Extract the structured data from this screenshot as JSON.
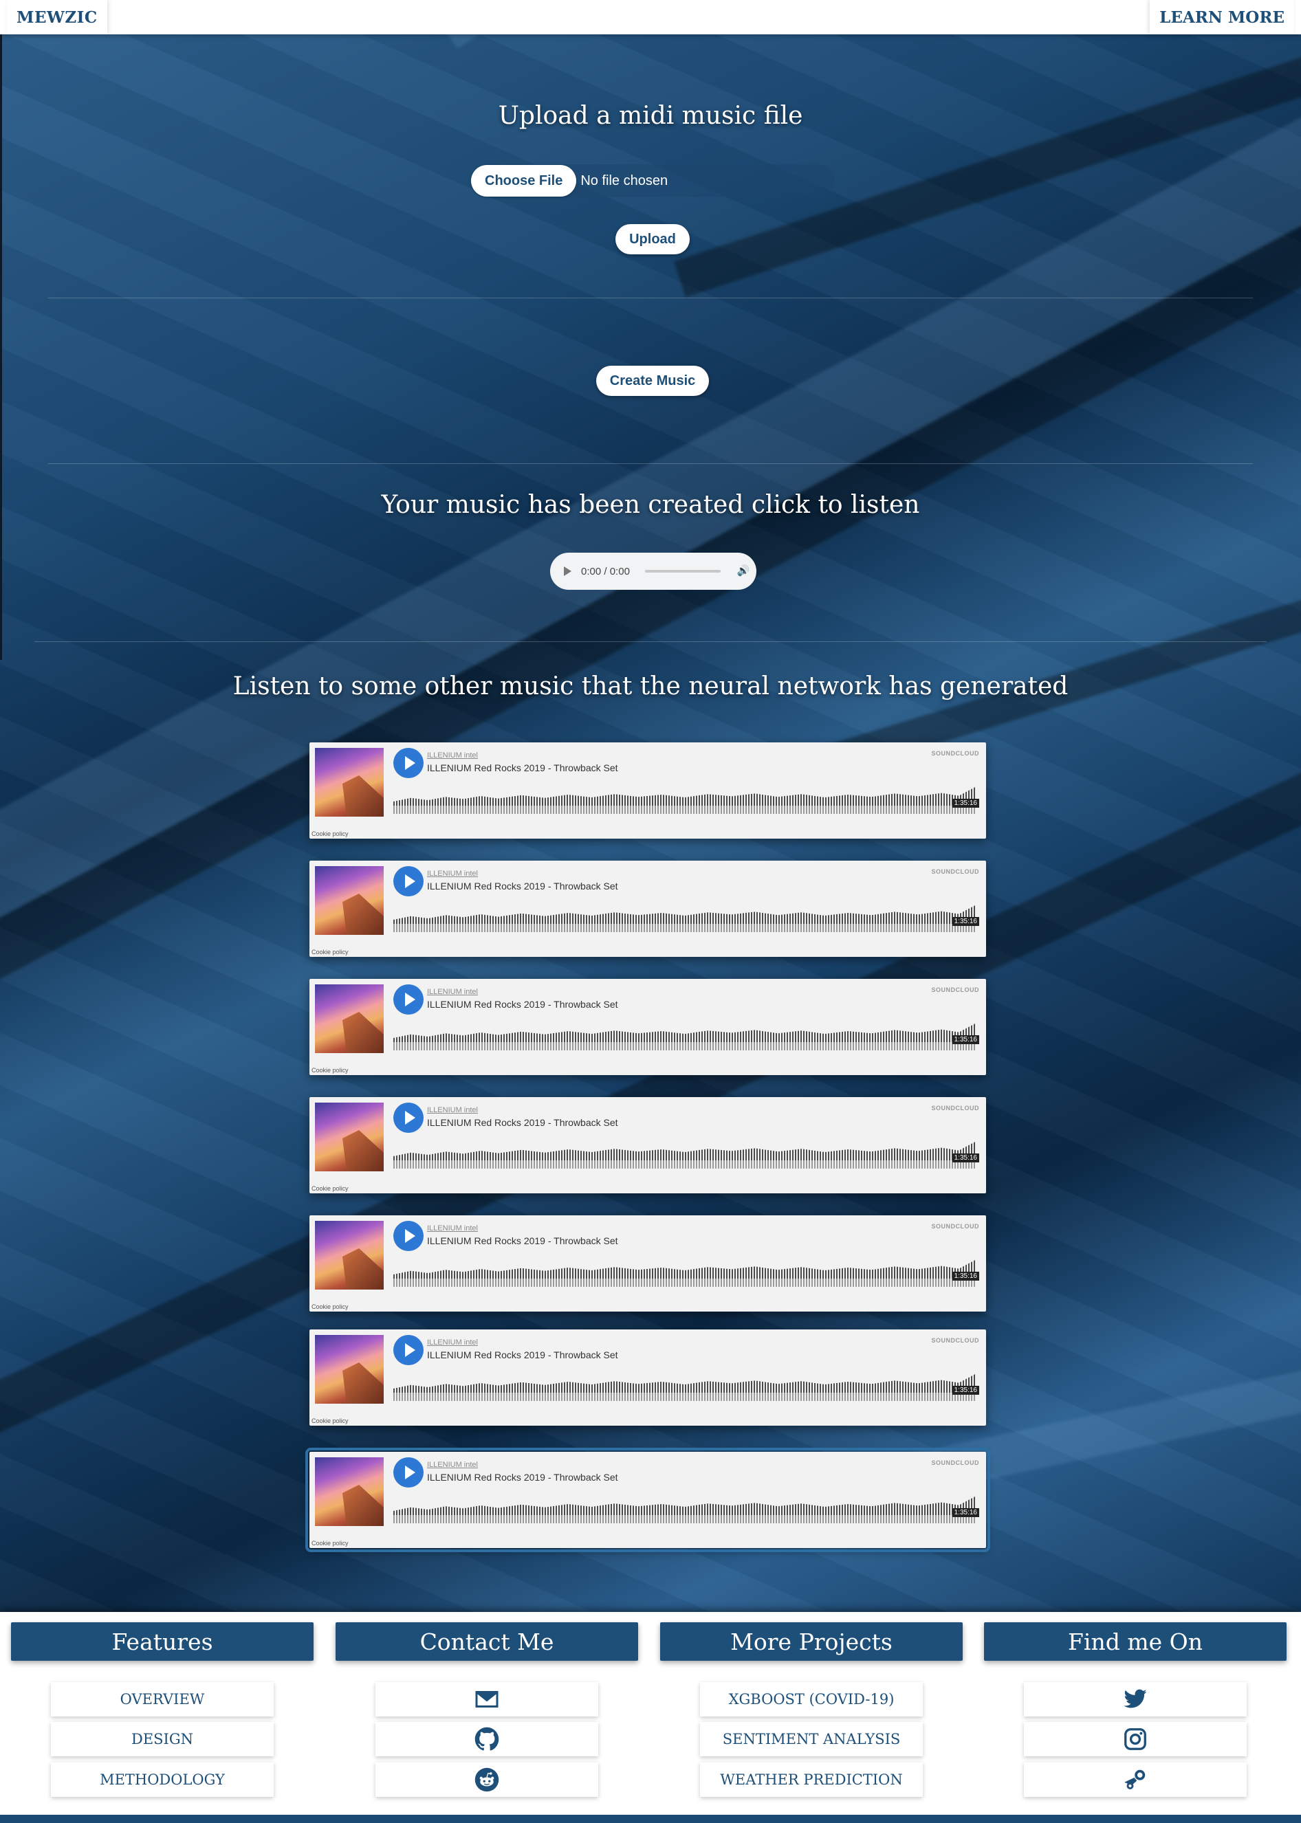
{
  "nav": {
    "brand": "MEWZIC",
    "learn_more": "LEARN MORE"
  },
  "upload": {
    "heading": "Upload a midi music file",
    "choose_file_label": "Choose File",
    "file_status": "No file chosen",
    "upload_button": "Upload"
  },
  "create": {
    "button": "Create Music"
  },
  "result": {
    "heading": "Your music has been created click to listen",
    "player": {
      "current_time": "0:00",
      "duration": "0:00"
    }
  },
  "gallery": {
    "heading": "Listen to some other music that the neural network has generated",
    "tracks": [
      {
        "artist": "ILLENIUM intel",
        "title": "ILLENIUM Red Rocks 2019 - Throwback Set",
        "duration": "1:35:16",
        "brand": "SOUNDCLOUD",
        "cookie": "Cookie policy"
      },
      {
        "artist": "ILLENIUM intel",
        "title": "ILLENIUM Red Rocks 2019 - Throwback Set",
        "duration": "1:35:16",
        "brand": "SOUNDCLOUD",
        "cookie": "Cookie policy"
      },
      {
        "artist": "ILLENIUM intel",
        "title": "ILLENIUM Red Rocks 2019 - Throwback Set",
        "duration": "1:35:16",
        "brand": "SOUNDCLOUD",
        "cookie": "Cookie policy"
      },
      {
        "artist": "ILLENIUM intel",
        "title": "ILLENIUM Red Rocks 2019 - Throwback Set",
        "duration": "1:35:16",
        "brand": "SOUNDCLOUD",
        "cookie": "Cookie policy"
      },
      {
        "artist": "ILLENIUM intel",
        "title": "ILLENIUM Red Rocks 2019 - Throwback Set",
        "duration": "1:35:16",
        "brand": "SOUNDCLOUD",
        "cookie": "Cookie policy"
      },
      {
        "artist": "ILLENIUM intel",
        "title": "ILLENIUM Red Rocks 2019 - Throwback Set",
        "duration": "1:35:16",
        "brand": "SOUNDCLOUD",
        "cookie": "Cookie policy"
      },
      {
        "artist": "ILLENIUM intel",
        "title": "ILLENIUM Red Rocks 2019 - Throwback Set",
        "duration": "1:35:16",
        "brand": "SOUNDCLOUD",
        "cookie": "Cookie policy"
      }
    ]
  },
  "footer": {
    "features": {
      "heading": "Features",
      "items": [
        "OVERVIEW",
        "DESIGN",
        "METHODOLOGY"
      ]
    },
    "contact": {
      "heading": "Contact Me",
      "icons": [
        "envelope-icon",
        "github-icon",
        "reddit-icon"
      ]
    },
    "projects": {
      "heading": "More Projects",
      "items": [
        "XGBOOST (COVID-19)",
        "SENTIMENT ANALYSIS",
        "WEATHER PREDICTION"
      ]
    },
    "social": {
      "heading": "Find me On",
      "icons": [
        "twitter-icon",
        "instagram-icon",
        "steam-icon"
      ]
    }
  },
  "colors": {
    "brand_blue": "#1d4f79",
    "soundcloud_play": "#2c78d4",
    "card_bg": "#f2f2f2"
  }
}
